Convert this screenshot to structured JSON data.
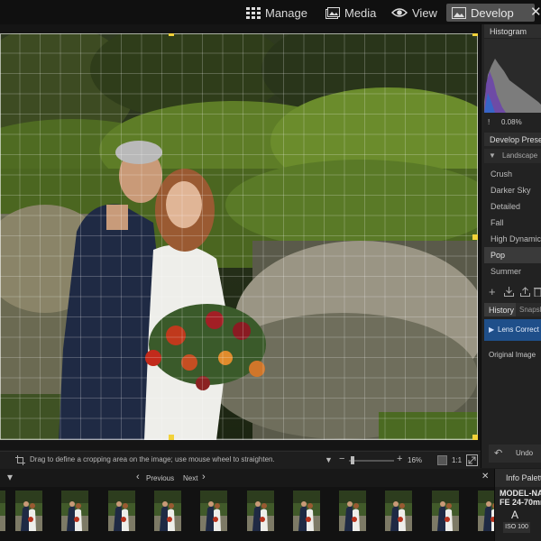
{
  "topbar": {
    "modes": [
      {
        "label": "Manage",
        "icon": "grid-icon",
        "active": false
      },
      {
        "label": "Media",
        "icon": "photos-icon",
        "active": false
      },
      {
        "label": "View",
        "icon": "eye-icon",
        "active": false
      },
      {
        "label": "Develop",
        "icon": "develop-icon",
        "active": true
      }
    ],
    "close_glyph": "✕"
  },
  "histogram": {
    "title": "Histogram",
    "readout_value": "0.08%"
  },
  "develop_presets": {
    "title": "Develop Prese",
    "category": "Landscape",
    "items": [
      "Crush",
      "Darker Sky",
      "Detailed",
      "Fall",
      "High Dynamic",
      "Pop",
      "Summer"
    ],
    "selected": "Pop"
  },
  "history": {
    "tabs": [
      "History",
      "Snapsh"
    ],
    "active_tab": "History",
    "items": [
      "Lens Correct",
      "Original Image"
    ]
  },
  "undo": {
    "label": "Undo"
  },
  "statusbar": {
    "hint": "Drag to define a cropping area on the image; use mouse wheel to straighten.",
    "zoom": "16%",
    "ratio": "1:1"
  },
  "filmstrip": {
    "previous_label": "Previous",
    "next_label": "Next",
    "thumbnail_count": 11
  },
  "info_palette": {
    "title": "Info Palette",
    "model": "MODEL-NA",
    "lens": "FE 24-70mm",
    "mode": "A",
    "iso": "ISO 100"
  },
  "colors": {
    "crop_handle": "#f2d23a",
    "accent_selected": "#1f4f8a",
    "active_tab": "#515151"
  }
}
